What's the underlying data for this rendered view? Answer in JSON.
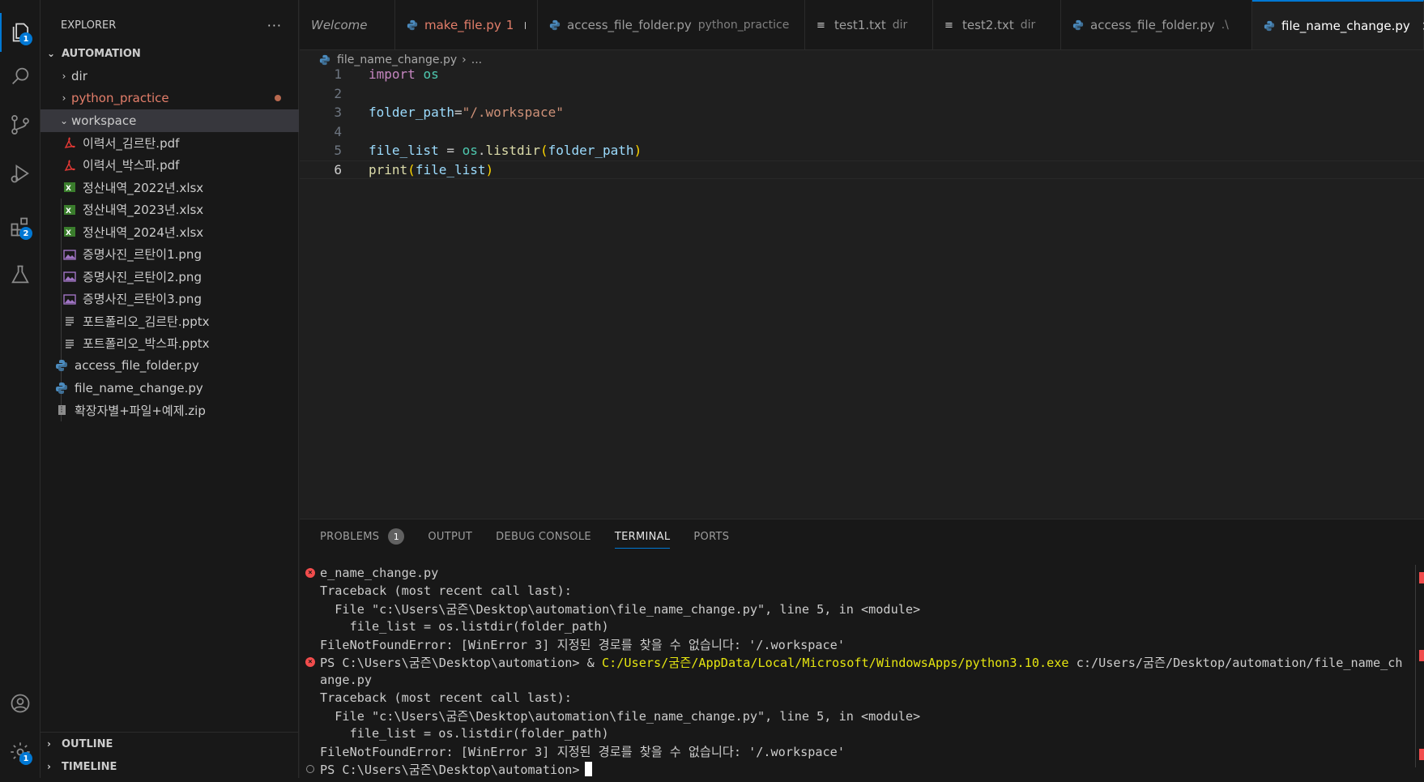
{
  "activity_bar": {
    "explorer_badge": "1",
    "extensions_badge": "2",
    "settings_badge": "1"
  },
  "sidebar": {
    "header": "EXPLORER",
    "more_label": "···",
    "workspace_title": "AUTOMATION",
    "tree": [
      {
        "label": "dir",
        "kind": "folder"
      },
      {
        "label": "python_practice",
        "kind": "folder"
      },
      {
        "label": "workspace",
        "kind": "folder"
      },
      {
        "label": "이력서_김르탄.pdf",
        "kind": "pdf"
      },
      {
        "label": "이력서_박스파.pdf",
        "kind": "pdf"
      },
      {
        "label": "정산내역_2022년.xlsx",
        "kind": "xlsx"
      },
      {
        "label": "정산내역_2023년.xlsx",
        "kind": "xlsx"
      },
      {
        "label": "정산내역_2024년.xlsx",
        "kind": "xlsx"
      },
      {
        "label": "증명사진_르탄이1.png",
        "kind": "png"
      },
      {
        "label": "증명사진_르탄이2.png",
        "kind": "png"
      },
      {
        "label": "증명사진_르탄이3.png",
        "kind": "png"
      },
      {
        "label": "포트폴리오_김르탄.pptx",
        "kind": "pptx"
      },
      {
        "label": "포트폴리오_박스파.pptx",
        "kind": "pptx"
      },
      {
        "label": "access_file_folder.py",
        "kind": "py"
      },
      {
        "label": "file_name_change.py",
        "kind": "py"
      },
      {
        "label": "확장자별+파일+예제.zip",
        "kind": "zip"
      }
    ],
    "outline": "OUTLINE",
    "timeline": "TIMELINE"
  },
  "tabs": [
    {
      "name": "Welcome",
      "desc": ""
    },
    {
      "name": "make_file.py",
      "desc": "1"
    },
    {
      "name": "access_file_folder.py",
      "desc": "python_practice"
    },
    {
      "name": "test1.txt",
      "desc": "dir"
    },
    {
      "name": "test2.txt",
      "desc": "dir"
    },
    {
      "name": "access_file_folder.py",
      "desc": ".\\"
    },
    {
      "name": "file_name_change.py",
      "desc": ""
    }
  ],
  "breadcrumb": {
    "file": "file_name_change.py",
    "sep": "›",
    "rest": "..."
  },
  "editor": {
    "line_numbers": [
      "1",
      "2",
      "3",
      "4",
      "5",
      "6"
    ],
    "line1": {
      "kw": "import",
      "mod": "os"
    },
    "line3": {
      "var": "folder_path",
      "eq": "=",
      "str": "\"/.workspace\""
    },
    "line5": {
      "var": "file_list",
      "eq": " = ",
      "mod": "os",
      "dot": ".",
      "fn": "listdir",
      "lp": "(",
      "arg": "folder_path",
      "rp": ")"
    },
    "line6": {
      "fn": "print",
      "lp": "(",
      "arg": "file_list",
      "rp": ")"
    }
  },
  "panel": {
    "tabs": [
      "PROBLEMS",
      "OUTPUT",
      "DEBUG CONSOLE",
      "TERMINAL",
      "PORTS"
    ],
    "problems_count": "1",
    "terminal": {
      "l1": "e_name_change.py",
      "l2": "Traceback (most recent call last):",
      "l3": "  File \"c:\\Users\\굼즌\\Desktop\\automation\\file_name_change.py\", line 5, in <module>",
      "l4": "    file_list = os.listdir(folder_path)",
      "l5": "FileNotFoundError: [WinError 3] 지정된 경로를 찾을 수 없습니다: '/.workspace'",
      "l6_prompt": "PS C:\\Users\\굼즌\\Desktop\\automation> & ",
      "l6_exe": "C:/Users/굼즌/AppData/Local/Microsoft/WindowsApps/python3.10.exe",
      "l6_arg": " c:/Users/굼즌/Desktop/automation/file_name_ch",
      "l7": "ange.py",
      "l8": "Traceback (most recent call last):",
      "l9": "  File \"c:\\Users\\굼즌\\Desktop\\automation\\file_name_change.py\", line 5, in <module>",
      "l10": "    file_list = os.listdir(folder_path)",
      "l11": "FileNotFoundError: [WinError 3] 지정된 경로를 찾을 수 없습니다: '/.workspace'",
      "l12": "PS C:\\Users\\굼즌\\Desktop\\automation>"
    }
  }
}
